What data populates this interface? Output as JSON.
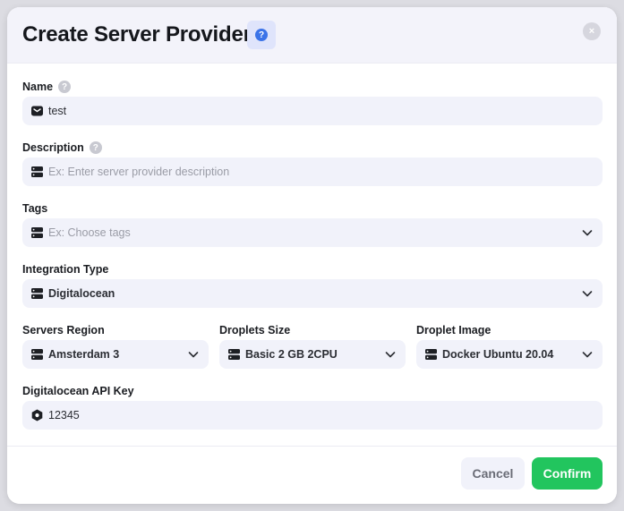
{
  "dialog": {
    "title": "Create Server Provider",
    "close_label": "×"
  },
  "colors": {
    "confirm": "#22c55e",
    "help_accent": "#3b73e8",
    "field_bg": "#f1f2fa"
  },
  "fields": {
    "name": {
      "label": "Name",
      "value": "test",
      "icon": "envelope-icon"
    },
    "description": {
      "label": "Description",
      "placeholder": "Ex: Enter server provider description",
      "icon": "server-icon"
    },
    "tags": {
      "label": "Tags",
      "placeholder": "Ex: Choose tags",
      "icon": "server-icon"
    },
    "integration_type": {
      "label": "Integration Type",
      "value": "Digitalocean",
      "icon": "server-icon"
    },
    "servers_region": {
      "label": "Servers Region",
      "value": "Amsterdam 3",
      "icon": "server-icon"
    },
    "droplets_size": {
      "label": "Droplets Size",
      "value": "Basic 2 GB 2CPU",
      "icon": "server-icon"
    },
    "droplet_image": {
      "label": "Droplet Image",
      "value": "Docker Ubuntu 20.04",
      "icon": "server-icon"
    },
    "api_key": {
      "label": "Digitalocean API Key",
      "value": "12345",
      "icon": "hexagon-icon"
    }
  },
  "footer": {
    "cancel_label": "Cancel",
    "confirm_label": "Confirm"
  }
}
